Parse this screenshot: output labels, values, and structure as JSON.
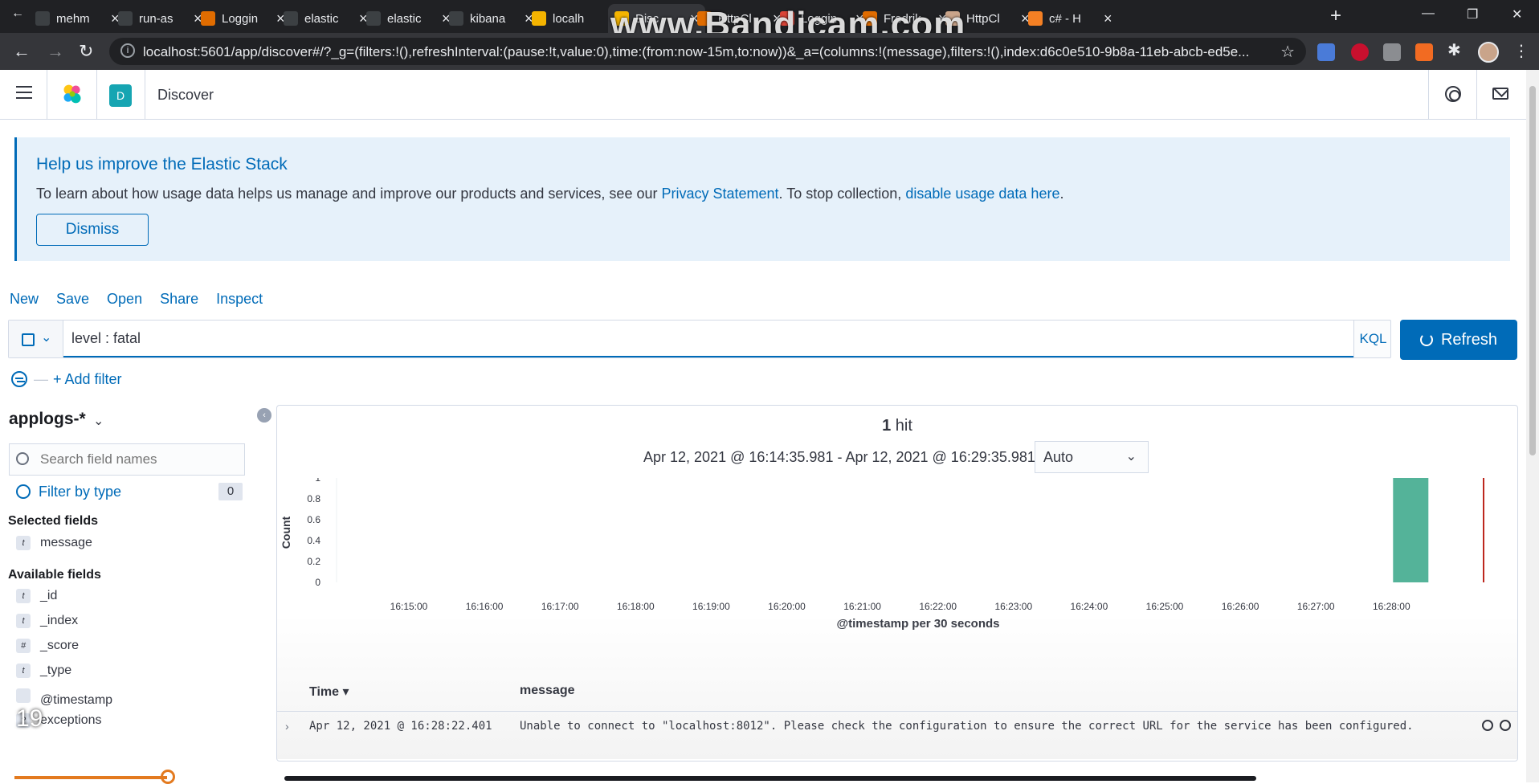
{
  "browser": {
    "tabs": [
      {
        "label": "mehm",
        "color": "#3c4043"
      },
      {
        "label": "run-as",
        "color": "#3c4043"
      },
      {
        "label": "Loggin",
        "color": "#e06c00"
      },
      {
        "label": "elastic",
        "color": "#3c4043"
      },
      {
        "label": "elastic",
        "color": "#3c4043"
      },
      {
        "label": "kibana",
        "color": "#3c4043"
      },
      {
        "label": "localh",
        "color": "#f4b400"
      },
      {
        "label": "Disc",
        "color": "#f4b400"
      },
      {
        "label": "HttpCl",
        "color": "#e06c00"
      },
      {
        "label": "Loggin",
        "color": "#db4437"
      },
      {
        "label": "Fredrik",
        "color": "#e06c00"
      },
      {
        "label": "HttpCl",
        "color": "#c9a48a"
      },
      {
        "label": "c# - H",
        "color": "#f48024"
      }
    ],
    "watermark": "www.Bandicam.com",
    "url": "localhost:5601/app/discover#/?_g=(filters:!(),refreshInterval:(pause:!t,value:0),time:(from:now-15m,to:now))&_a=(columns:!(message),filters:!(),index:d6c0e510-9b8a-11eb-abcb-ed5e..."
  },
  "header": {
    "space_initial": "D",
    "breadcrumb": "Discover"
  },
  "callout": {
    "title": "Help us improve the Elastic Stack",
    "body_prefix": "To learn about how usage data helps us manage and improve our products and services, see our ",
    "privacy_link": "Privacy Statement",
    "body_mid": ". To stop collection, ",
    "disable_link": "disable usage data here",
    "body_suffix": ".",
    "dismiss_label": "Dismiss"
  },
  "topnav": {
    "new": "New",
    "save": "Save",
    "open": "Open",
    "share": "Share",
    "inspect": "Inspect"
  },
  "query": {
    "value": "level : fatal",
    "language": "KQL",
    "refresh_label": "Refresh",
    "add_filter": "+ Add filter"
  },
  "sidebar": {
    "index_pattern": "applogs-*",
    "search_placeholder": "Search field names",
    "filter_by_type": "Filter by type",
    "filter_count": "0",
    "selected_label": "Selected fields",
    "selected_fields": [
      {
        "type": "t",
        "name": "message"
      }
    ],
    "available_label": "Available fields",
    "available_fields": [
      {
        "type": "t",
        "name": "_id"
      },
      {
        "type": "t",
        "name": "_index"
      },
      {
        "type": "#",
        "name": "_score"
      },
      {
        "type": "t",
        "name": "_type"
      },
      {
        "type": "",
        "name": "@timestamp"
      },
      {
        "type": "?",
        "name": "exceptions"
      }
    ],
    "overlay_number": "19"
  },
  "results": {
    "hit_count": "1",
    "hit_label": "hit",
    "time_range": "Apr 12, 2021 @ 16:14:35.981 - Apr 12, 2021 @ 16:29:35.981",
    "interval": "Auto",
    "columns": {
      "time": "Time",
      "message": "message"
    },
    "rows": [
      {
        "time": "Apr 12, 2021 @ 16:28:22.401",
        "message": "Unable to connect to \"localhost:8012\". Please check the configuration to ensure the correct URL for the service has been configured."
      }
    ]
  },
  "chart_data": {
    "type": "bar",
    "ylabel": "Count",
    "xlabel": "@timestamp per 30 seconds",
    "ylim": [
      0,
      1
    ],
    "y_ticks": [
      "0",
      "0.2",
      "0.4",
      "0.6",
      "0.8",
      "1"
    ],
    "x_ticks": [
      "16:15:00",
      "16:16:00",
      "16:17:00",
      "16:18:00",
      "16:19:00",
      "16:20:00",
      "16:21:00",
      "16:22:00",
      "16:23:00",
      "16:24:00",
      "16:25:00",
      "16:26:00",
      "16:27:00",
      "16:28:00"
    ],
    "bars": [
      {
        "x": "16:28:00",
        "value": 1
      }
    ],
    "bar_color": "#54b399",
    "now_marker_color": "#bd271e",
    "grid": false
  }
}
